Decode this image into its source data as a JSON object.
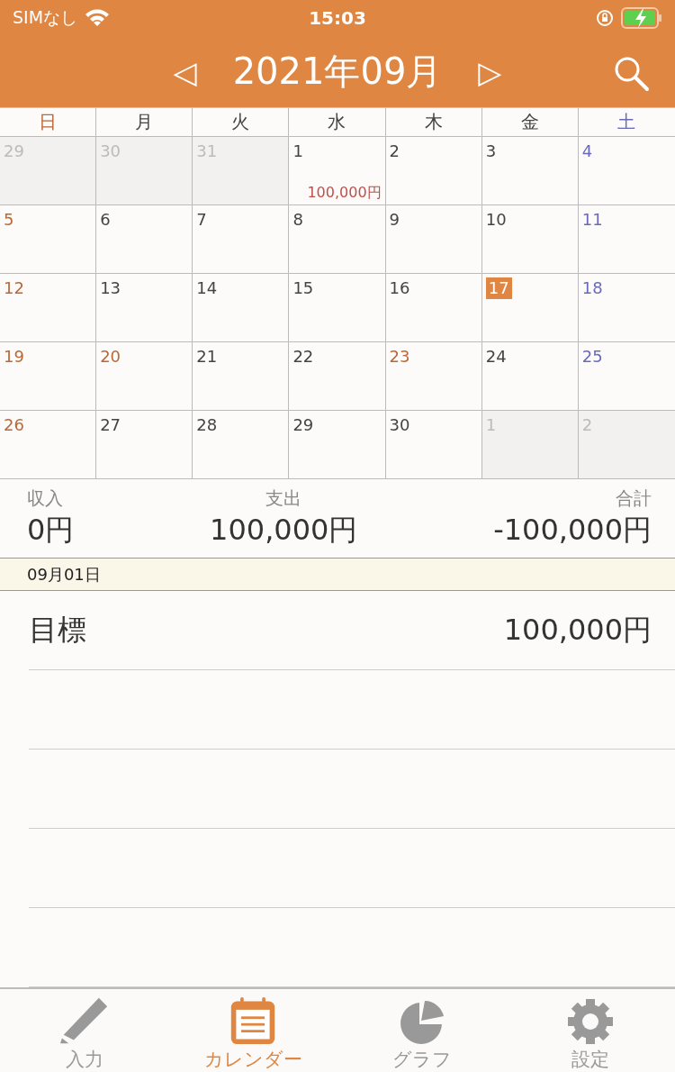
{
  "status_bar": {
    "carrier": "SIMなし",
    "time": "15:03"
  },
  "header": {
    "title": "2021年09月",
    "prev": "◁",
    "next": "▷"
  },
  "weekdays": [
    {
      "label": "日",
      "kind": "sun"
    },
    {
      "label": "月",
      "kind": "weekday"
    },
    {
      "label": "火",
      "kind": "weekday"
    },
    {
      "label": "水",
      "kind": "weekday"
    },
    {
      "label": "木",
      "kind": "weekday"
    },
    {
      "label": "金",
      "kind": "weekday"
    },
    {
      "label": "土",
      "kind": "sat"
    }
  ],
  "days": [
    {
      "day": "29",
      "kind": "outside",
      "selected": false
    },
    {
      "day": "30",
      "kind": "outside",
      "selected": false
    },
    {
      "day": "31",
      "kind": "outside",
      "selected": false
    },
    {
      "day": "1",
      "kind": "weekday",
      "selected": false,
      "amount": "100,000円"
    },
    {
      "day": "2",
      "kind": "weekday",
      "selected": false
    },
    {
      "day": "3",
      "kind": "weekday",
      "selected": false
    },
    {
      "day": "4",
      "kind": "sat",
      "selected": false
    },
    {
      "day": "5",
      "kind": "sun",
      "selected": false
    },
    {
      "day": "6",
      "kind": "weekday",
      "selected": false
    },
    {
      "day": "7",
      "kind": "weekday",
      "selected": false
    },
    {
      "day": "8",
      "kind": "weekday",
      "selected": false
    },
    {
      "day": "9",
      "kind": "weekday",
      "selected": false
    },
    {
      "day": "10",
      "kind": "weekday",
      "selected": false
    },
    {
      "day": "11",
      "kind": "sat",
      "selected": false
    },
    {
      "day": "12",
      "kind": "sun",
      "selected": false
    },
    {
      "day": "13",
      "kind": "weekday",
      "selected": false
    },
    {
      "day": "14",
      "kind": "weekday",
      "selected": false
    },
    {
      "day": "15",
      "kind": "weekday",
      "selected": false
    },
    {
      "day": "16",
      "kind": "weekday",
      "selected": false
    },
    {
      "day": "17",
      "kind": "weekday",
      "selected": true
    },
    {
      "day": "18",
      "kind": "sat",
      "selected": false
    },
    {
      "day": "19",
      "kind": "sun",
      "selected": false
    },
    {
      "day": "20",
      "kind": "holiday",
      "selected": false
    },
    {
      "day": "21",
      "kind": "weekday",
      "selected": false
    },
    {
      "day": "22",
      "kind": "weekday",
      "selected": false
    },
    {
      "day": "23",
      "kind": "holiday",
      "selected": false
    },
    {
      "day": "24",
      "kind": "weekday",
      "selected": false
    },
    {
      "day": "25",
      "kind": "sat",
      "selected": false
    },
    {
      "day": "26",
      "kind": "sun",
      "selected": false
    },
    {
      "day": "27",
      "kind": "weekday",
      "selected": false
    },
    {
      "day": "28",
      "kind": "weekday",
      "selected": false
    },
    {
      "day": "29",
      "kind": "weekday",
      "selected": false
    },
    {
      "day": "30",
      "kind": "weekday",
      "selected": false
    },
    {
      "day": "1",
      "kind": "outside",
      "selected": false
    },
    {
      "day": "2",
      "kind": "outside",
      "selected": false
    }
  ],
  "summary": [
    {
      "label": "収入",
      "value": "0円"
    },
    {
      "label": "支出",
      "value": "100,000円"
    },
    {
      "label": "合計",
      "value": "-100,000円"
    }
  ],
  "date_bar": "09月01日",
  "entries": [
    {
      "name": "目標",
      "amount": "100,000円"
    }
  ],
  "tabs": [
    {
      "label": "入力",
      "kind": "input",
      "selected": false
    },
    {
      "label": "カレンダー",
      "kind": "calendar",
      "selected": true
    },
    {
      "label": "グラフ",
      "kind": "graph",
      "selected": false
    },
    {
      "label": "設定",
      "kind": "settings",
      "selected": false
    }
  ]
}
